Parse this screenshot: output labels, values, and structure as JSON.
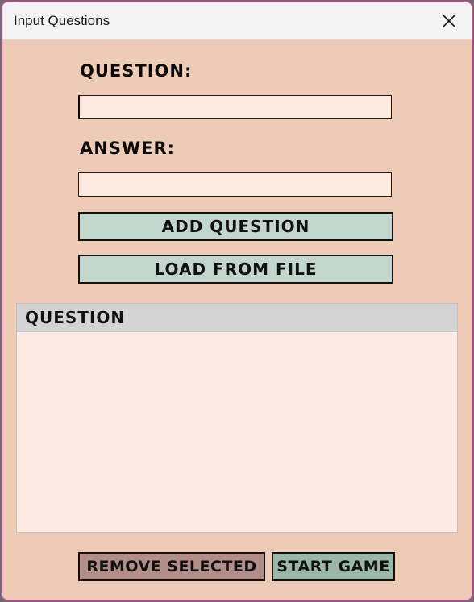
{
  "window": {
    "title": "Input Questions",
    "close_symbol": "✕",
    "icons": [
      "close-icon"
    ]
  },
  "form": {
    "question_label": "Question:",
    "question_value": "",
    "answer_label": "Answer:",
    "answer_value": ""
  },
  "buttons": {
    "add_question": "Add Question",
    "load_from_file": "Load From File",
    "remove_selected": "Remove Selected",
    "start_game": "Start Game"
  },
  "question_list": {
    "column_header": "Question",
    "rows": []
  },
  "colors": {
    "window_bg": "#eecbb5",
    "titlebar_bg": "#f3f3f3",
    "input_bg": "#fde9e0",
    "action_button_bg": "#c2d6cd",
    "remove_button_bg": "#b18e88",
    "start_button_bg": "#9ab8a8",
    "list_header_bg": "#d4d4d4",
    "border_accent": "#b14f8a"
  }
}
